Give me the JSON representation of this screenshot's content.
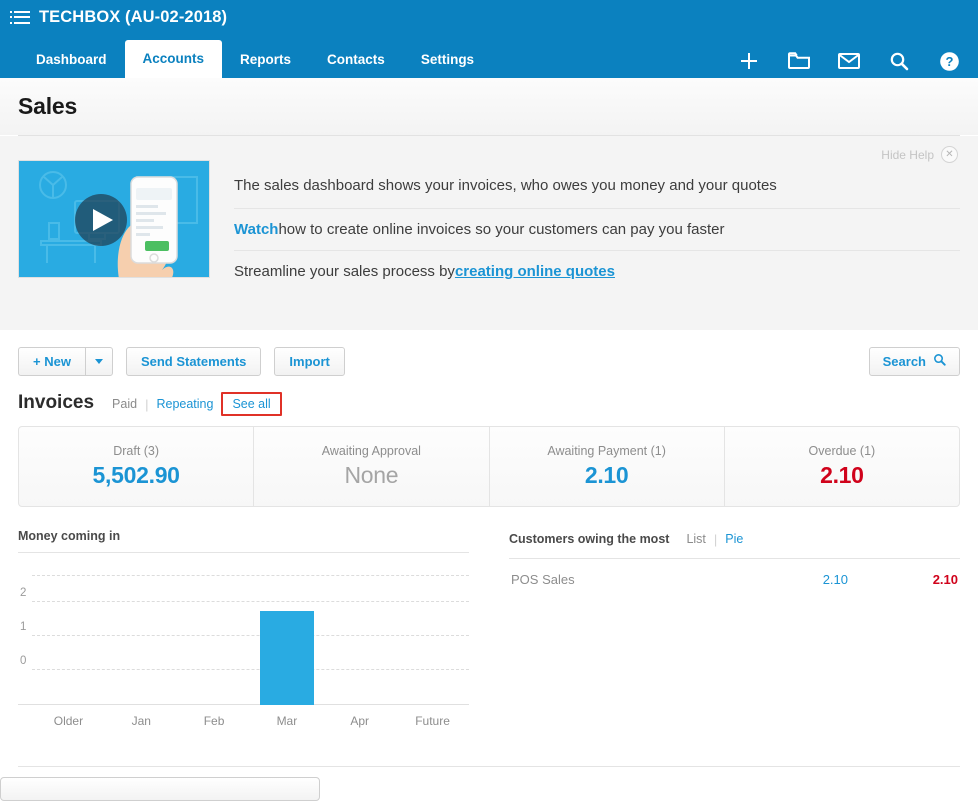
{
  "topbar": {
    "menu_icon": "hamburger-menu-icon",
    "brand": "TECHBOX (AU-02-2018)",
    "tabs": [
      {
        "label": "Dashboard",
        "active": false
      },
      {
        "label": "Accounts",
        "active": true
      },
      {
        "label": "Reports",
        "active": false
      },
      {
        "label": "Contacts",
        "active": false
      },
      {
        "label": "Settings",
        "active": false
      }
    ],
    "icons": [
      {
        "name": "plus-icon"
      },
      {
        "name": "folder-icon"
      },
      {
        "name": "envelope-icon"
      },
      {
        "name": "search-icon"
      },
      {
        "name": "help-icon"
      }
    ]
  },
  "page": {
    "title": "Sales"
  },
  "help": {
    "hide_label": "Hide Help",
    "close_icon": "close-icon",
    "video_alt": "play-video-thumbnail",
    "line1": "The sales dashboard shows your invoices, who owes you money and your quotes",
    "line2_link": "Watch",
    "line2_rest": " how to create online invoices so your customers can pay you faster",
    "line3_pre": "Streamline your sales process by ",
    "line3_link": "creating online quotes"
  },
  "toolbar": {
    "new_label": "+ New",
    "new_caret": "chevron-down-icon",
    "send_statements_label": "Send Statements",
    "import_label": "Import",
    "search_label": "Search",
    "search_icon": "search-icon"
  },
  "invoices": {
    "title": "Invoices",
    "tabs": [
      {
        "label": "Paid",
        "style": "muted"
      },
      {
        "label": "Repeating",
        "style": "link"
      },
      {
        "label": "See all",
        "style": "highlighted"
      }
    ],
    "separator": "|",
    "cards": [
      {
        "label": "Draft (3)",
        "value": "5,502.90",
        "color": "blue"
      },
      {
        "label": "Awaiting Approval",
        "value": "None",
        "color": "grey"
      },
      {
        "label": "Awaiting Payment (1)",
        "value": "2.10",
        "color": "blue"
      },
      {
        "label": "Overdue (1)",
        "value": "2.10",
        "color": "red"
      }
    ]
  },
  "money_panel": {
    "title": "Money coming in"
  },
  "customers_panel": {
    "title": "Customers owing the most",
    "view_list": "List",
    "view_pie": "Pie",
    "separator": "|",
    "rows": [
      {
        "name": "POS Sales",
        "amount_due": "2.10",
        "amount_overdue": "2.10"
      }
    ]
  },
  "colors": {
    "header_blue": "#0b81bf",
    "link_blue": "#1b94d4",
    "bar_blue": "#29abe2",
    "danger_red": "#d0021b",
    "highlight_red": "#e03127",
    "muted_grey": "#8d8d8d"
  },
  "chart_data": {
    "type": "bar",
    "title": "Money coming in",
    "categories": [
      "Older",
      "Jan",
      "Feb",
      "Mar",
      "Apr",
      "Future"
    ],
    "values": [
      0,
      0,
      0,
      2,
      0,
      0
    ],
    "ytick_labels": [
      "0",
      "1",
      "2"
    ],
    "ytick_values": [
      0,
      1,
      2
    ],
    "ylim": [
      0,
      2.4
    ],
    "xlabel": "",
    "ylabel": "",
    "grid": true,
    "legend": "none",
    "series_color": "#29abe2"
  }
}
